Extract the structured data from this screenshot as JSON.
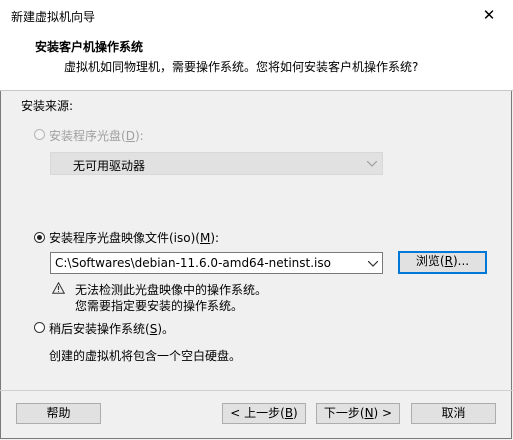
{
  "window": {
    "title": "新建虚拟机向导",
    "close_glyph": "✕"
  },
  "header": {
    "title": "安装客户机操作系统",
    "subtitle": "虚拟机如同物理机，需要操作系统。您将如何安装客户机操作系统?"
  },
  "source": {
    "label": "安装来源:",
    "disc": {
      "label_pre": "安装程序光盘(",
      "key": "D",
      "label_post": "):",
      "selected": false,
      "enabled": false,
      "drive_value": "无可用驱动器"
    },
    "iso": {
      "label_pre": "安装程序光盘映像文件(iso)(",
      "key": "M",
      "label_post": "):",
      "selected": true,
      "enabled": true,
      "path": "C:\\Softwares\\debian-11.6.0-amd64-netinst.iso",
      "browse_pre": "浏览(",
      "browse_key": "R",
      "browse_post": ")...",
      "warning_line1": "无法检测此光盘映像中的操作系统。",
      "warning_line2": "您需要指定要安装的操作系统。"
    },
    "later": {
      "label_pre": "稍后安装操作系统(",
      "key": "S",
      "label_post": ")。",
      "selected": false,
      "description": "创建的虚拟机将包含一个空白硬盘。"
    }
  },
  "footer": {
    "help": "帮助",
    "back_pre": "< 上一步(",
    "back_key": "B",
    "back_post": ")",
    "next_pre": "下一步(",
    "next_key": "N",
    "next_post": ") >",
    "cancel": "取消"
  },
  "icons": {
    "warning": "warning-triangle-icon",
    "dropdown": "chevron-down-icon"
  }
}
